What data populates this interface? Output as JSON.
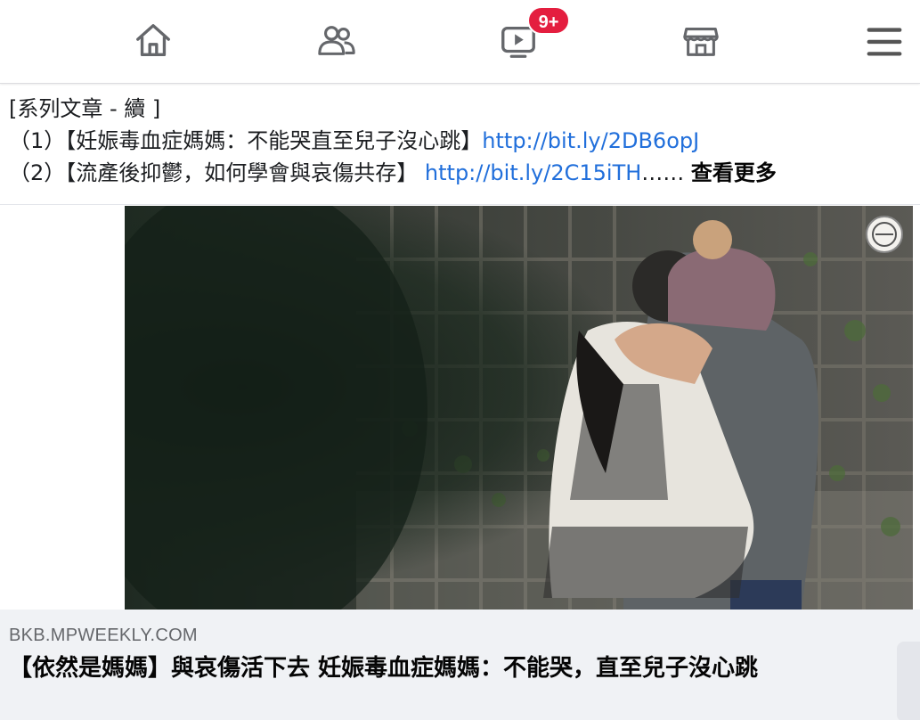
{
  "nav": {
    "items": [
      {
        "name": "home",
        "icon": "home-icon"
      },
      {
        "name": "friends",
        "icon": "friends-icon"
      },
      {
        "name": "watch",
        "icon": "video-icon",
        "badge": "9+"
      },
      {
        "name": "marketplace",
        "icon": "shop-icon"
      },
      {
        "name": "menu",
        "icon": "menu-icon"
      }
    ],
    "watch_badge": "9+"
  },
  "post": {
    "line1": "[系列文章 - 續 ]",
    "line2_text": "（1）【妊娠毒血症媽媽：不能哭直至兒子沒心跳】",
    "line2_link": "http://bit.ly/2DB6opJ",
    "line3_text": "（2）【流產後抑鬱，如何學會與哀傷共存】 ",
    "line3_link": "http://bit.ly/2C15iTH",
    "line3_ellipsis": "……",
    "see_more": "查看更多"
  },
  "photo": {
    "watermark_icon": "publisher-logo-icon"
  },
  "preview": {
    "domain": "BKB.MPWEEKLY.COM",
    "title": "【依然是媽媽】與哀傷活下去 妊娠毒血症媽媽：不能哭，直至兒子沒心跳"
  },
  "colors": {
    "link": "#216fdb",
    "badge": "#e41e3f",
    "icon": "#65676b",
    "preview_bg": "#f0f2f5"
  }
}
